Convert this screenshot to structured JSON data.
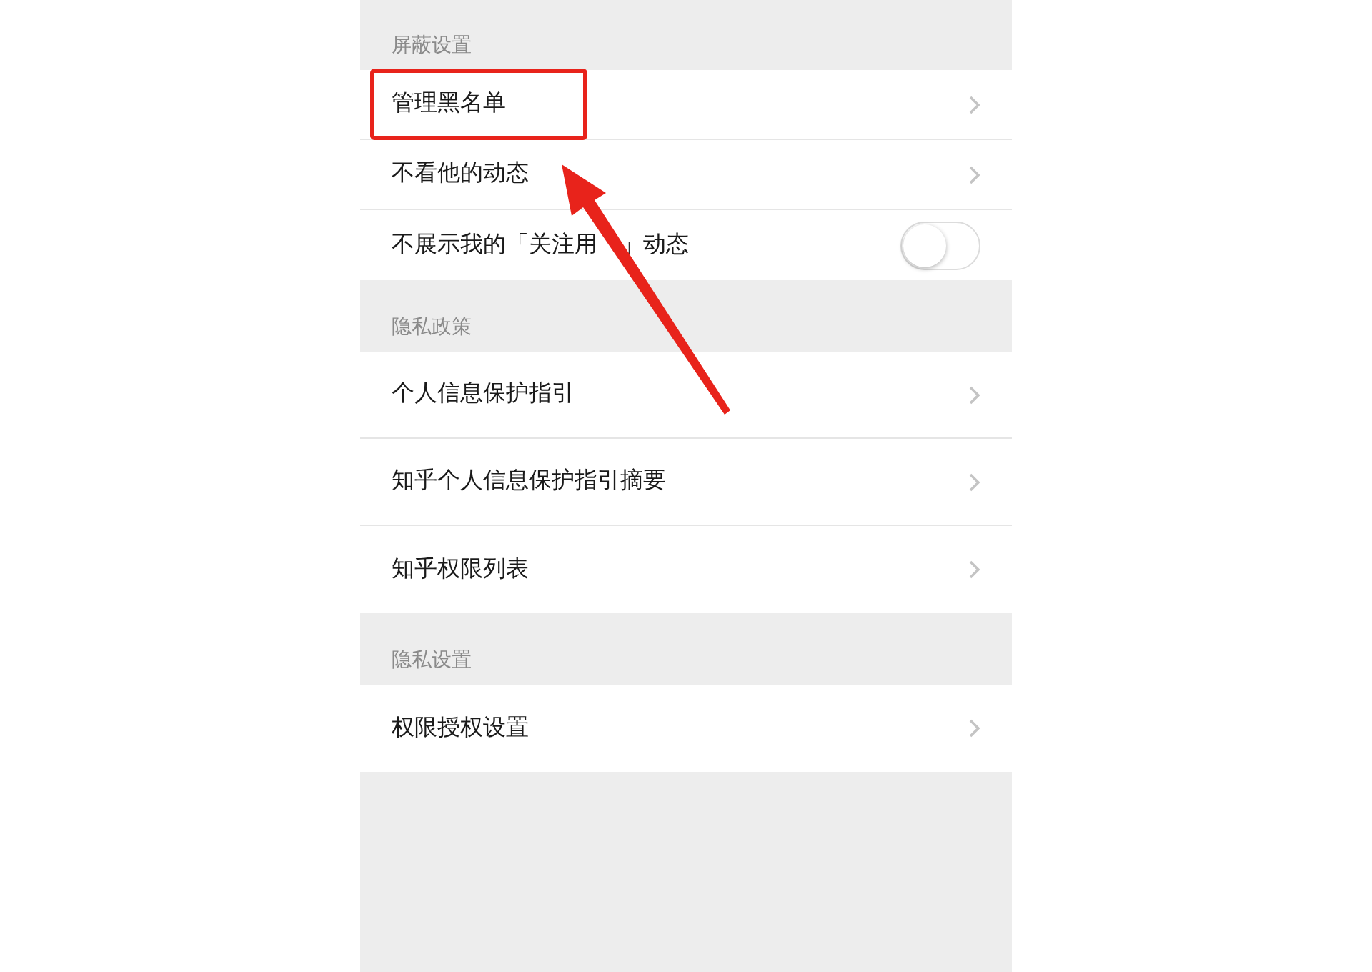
{
  "sections": [
    {
      "title": "屏蔽设置",
      "items": [
        {
          "kind": "link",
          "label": "管理黑名单",
          "highlighted": true
        },
        {
          "kind": "link",
          "label": "不看他的动态",
          "highlighted": false
        },
        {
          "kind": "toggle",
          "label_parts": [
            "不展示我的「关注用",
            "」动态"
          ],
          "on": false,
          "highlighted": false
        }
      ]
    },
    {
      "title": "隐私政策",
      "items": [
        {
          "kind": "link",
          "label": "个人信息保护指引",
          "highlighted": false
        },
        {
          "kind": "link",
          "label": "知乎个人信息保护指引摘要",
          "highlighted": false
        },
        {
          "kind": "link",
          "label": "知乎权限列表",
          "highlighted": false
        }
      ]
    },
    {
      "title": "隐私设置",
      "items": [
        {
          "kind": "link",
          "label": "权限授权设置",
          "highlighted": false
        }
      ]
    }
  ]
}
